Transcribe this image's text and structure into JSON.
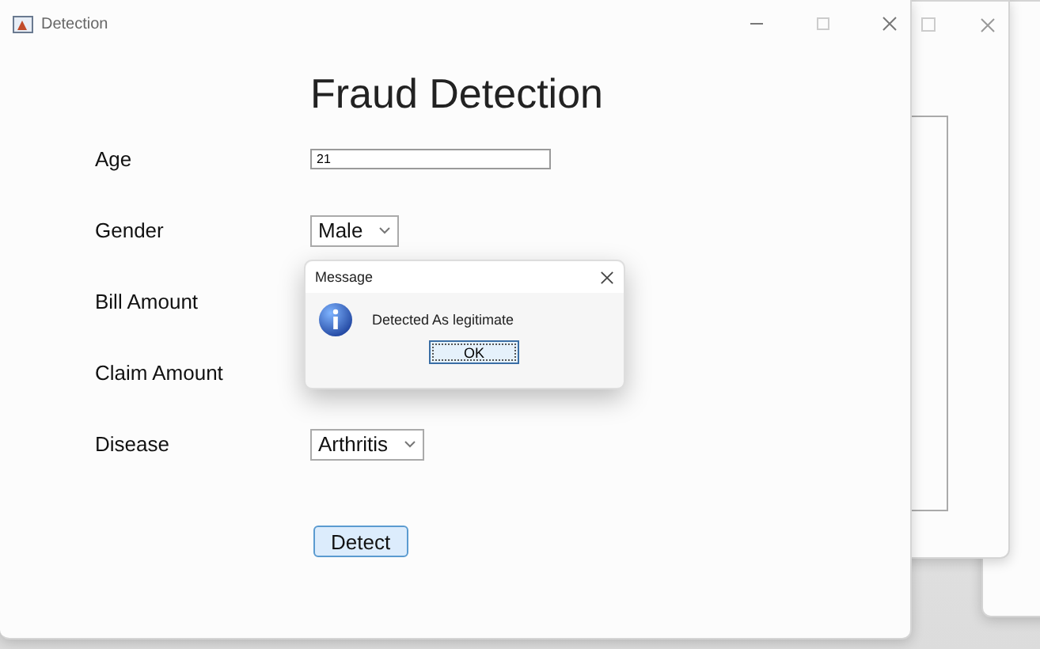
{
  "window": {
    "title": "Detection"
  },
  "heading": "Fraud Detection",
  "fields": [
    {
      "label": "Age",
      "kind": "text",
      "value": "21"
    },
    {
      "label": "Gender",
      "kind": "select",
      "value": "Male"
    },
    {
      "label": "Bill Amount",
      "kind": "covered"
    },
    {
      "label": "Claim Amount",
      "kind": "covered"
    },
    {
      "label": "Disease",
      "kind": "select",
      "value": "Arthritis"
    }
  ],
  "button": "Detect",
  "dialog": {
    "title": "Message",
    "message": "Detected As legitimate",
    "button": "OK"
  }
}
